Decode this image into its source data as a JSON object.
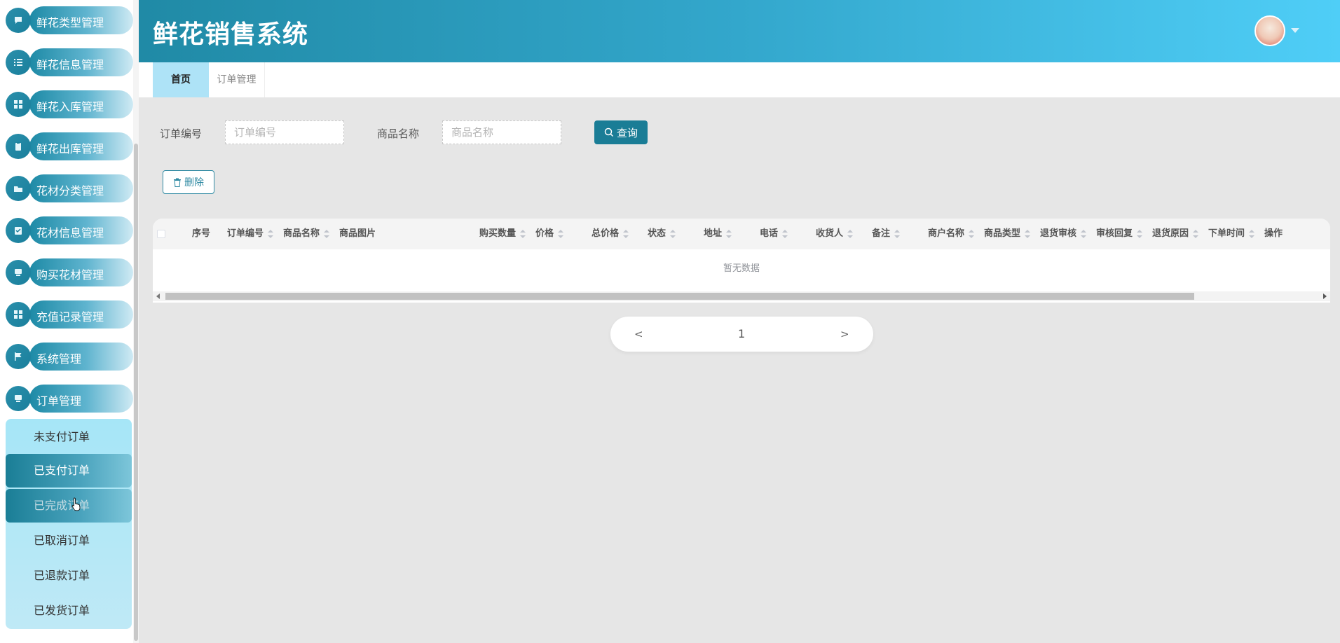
{
  "app": {
    "title": "鲜花销售系统"
  },
  "sidebar": {
    "items": [
      {
        "label": "鲜花类型管理",
        "icon": "chat-icon"
      },
      {
        "label": "鲜花信息管理",
        "icon": "list-icon"
      },
      {
        "label": "鲜花入库管理",
        "icon": "grid-icon"
      },
      {
        "label": "鲜花出库管理",
        "icon": "clipboard-icon"
      },
      {
        "label": "花材分类管理",
        "icon": "folder-icon"
      },
      {
        "label": "花材信息管理",
        "icon": "checklist-icon"
      },
      {
        "label": "购买花材管理",
        "icon": "monitor-icon"
      },
      {
        "label": "充值记录管理",
        "icon": "grid-icon"
      },
      {
        "label": "系统管理",
        "icon": "flag-icon"
      },
      {
        "label": "订单管理",
        "icon": "monitor-icon"
      }
    ],
    "submenu": [
      {
        "label": "未支付订单"
      },
      {
        "label": "已支付订单"
      },
      {
        "label": "已完成订单"
      },
      {
        "label": "已取消订单"
      },
      {
        "label": "已退款订单"
      },
      {
        "label": "已发货订单"
      }
    ]
  },
  "tabs": [
    {
      "label": "首页"
    },
    {
      "label": "订单管理"
    }
  ],
  "search": {
    "order_no_label": "订单编号",
    "order_no_placeholder": "订单编号",
    "product_name_label": "商品名称",
    "product_name_placeholder": "商品名称",
    "query_label": "查询"
  },
  "actions": {
    "delete_label": "删除"
  },
  "table": {
    "columns": [
      {
        "label": "序号",
        "sortable": false
      },
      {
        "label": "订单编号",
        "sortable": true
      },
      {
        "label": "商品名称",
        "sortable": true
      },
      {
        "label": "商品图片",
        "sortable": false
      },
      {
        "label": "购买数量",
        "sortable": true
      },
      {
        "label": "价格",
        "sortable": true
      },
      {
        "label": "总价格",
        "sortable": true
      },
      {
        "label": "状态",
        "sortable": true
      },
      {
        "label": "地址",
        "sortable": true
      },
      {
        "label": "电话",
        "sortable": true
      },
      {
        "label": "收货人",
        "sortable": true
      },
      {
        "label": "备注",
        "sortable": true
      },
      {
        "label": "商户名称",
        "sortable": true
      },
      {
        "label": "商品类型",
        "sortable": true
      },
      {
        "label": "退货审核",
        "sortable": true
      },
      {
        "label": "审核回复",
        "sortable": true
      },
      {
        "label": "退货原因",
        "sortable": true
      },
      {
        "label": "下单时间",
        "sortable": true
      },
      {
        "label": "操作",
        "sortable": false
      }
    ],
    "empty_text": "暂无数据"
  },
  "pagination": {
    "prev": "<",
    "current": "1",
    "next": ">"
  },
  "colors": {
    "accent": "#1a7d96",
    "header_start": "#208aa6",
    "header_end": "#4fcef7",
    "tab_active": "#aee3f7"
  }
}
